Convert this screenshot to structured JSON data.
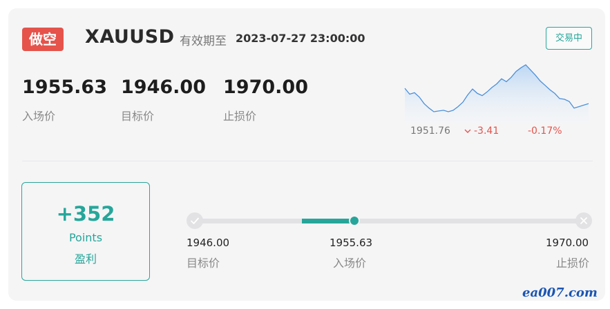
{
  "header": {
    "direction_badge": "做空",
    "symbol": "XAUUSD",
    "valid_label": "有效期至",
    "valid_until": "2023-07-27 23:00:00",
    "status": "交易中"
  },
  "prices": [
    {
      "value": "1955.63",
      "label": "入场价"
    },
    {
      "value": "1946.00",
      "label": "目标价"
    },
    {
      "value": "1970.00",
      "label": "止损价"
    }
  ],
  "market": {
    "last": "1951.76",
    "change": "-3.41",
    "change_pct": "-0.17%",
    "change_arrow": "down-chevron-icon"
  },
  "sparkline": {
    "values": [
      1953.8,
      1953.0,
      1953.2,
      1952.6,
      1951.7,
      1951.1,
      1950.6,
      1950.7,
      1950.8,
      1950.6,
      1950.8,
      1951.3,
      1951.9,
      1952.9,
      1953.7,
      1953.1,
      1952.8,
      1953.3,
      1953.9,
      1954.4,
      1955.1,
      1954.7,
      1955.3,
      1956.1,
      1956.6,
      1957.0,
      1956.3,
      1955.6,
      1954.8,
      1954.2,
      1953.6,
      1953.1,
      1952.4,
      1952.3,
      1952.0,
      1951.1,
      1951.3,
      1951.5,
      1951.7
    ],
    "line_color": "#4a90d9",
    "fill_color": "#cfe2f6"
  },
  "pnl": {
    "value": "+352",
    "unit": "Points",
    "label": "盈利"
  },
  "levels": {
    "target": {
      "value": "1946.00",
      "label": "目标价"
    },
    "entry": {
      "value": "1955.63",
      "label": "入场价"
    },
    "stop": {
      "value": "1970.00",
      "label": "止损价"
    },
    "target_icon": "check-icon",
    "stop_icon": "close-icon"
  },
  "progress": {
    "entry_fraction": 0.41,
    "fill_from_fraction": 0.275
  },
  "colors": {
    "accent": "#26a69a",
    "short_badge": "#e5534b",
    "negative": "#e5534b"
  },
  "watermark": "ea007.com"
}
